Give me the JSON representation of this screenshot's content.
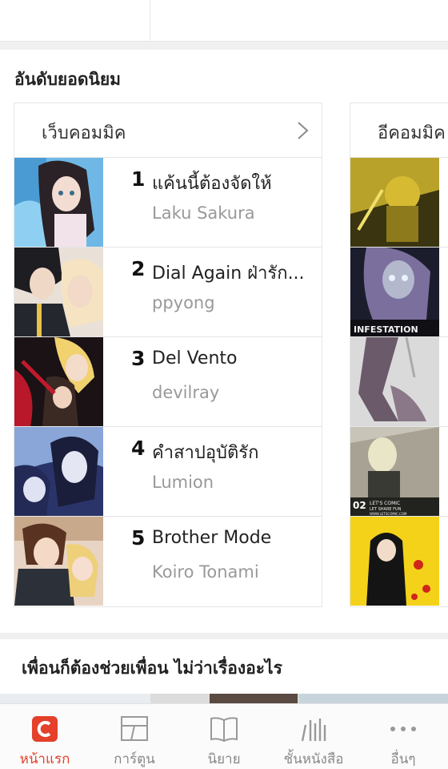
{
  "top_strip": {},
  "ranking": {
    "section_title": "อันดับยอดนิยม",
    "web_comic": {
      "header_label": "เว็บคอมมิค",
      "items": [
        {
          "rank": "1",
          "title": "แค้นนี้ต้องจัดให้",
          "author": "Laku Sakura"
        },
        {
          "rank": "2",
          "title": "Dial Again ฝ่ารัก...",
          "author": "ppyong"
        },
        {
          "rank": "3",
          "title": "Del Vento",
          "author": "devilray"
        },
        {
          "rank": "4",
          "title": "คำสาปอุบัติรัก",
          "author": "Lumion"
        },
        {
          "rank": "5",
          "title": "Brother Mode",
          "author": "Koiro Tonami"
        }
      ]
    },
    "e_comic": {
      "header_label": "อีคอมมิค",
      "thumb_texts": [
        "INFESTATION",
        "02",
        "LET'S COMIC",
        "LET SHARE FUN",
        "WWW.LETSCOMIC.COM"
      ]
    }
  },
  "friends_section": {
    "title": "เพื่อนก็ต้องช่วยเพื่อน ไม่ว่าเรื่องอะไร"
  },
  "tab_bar": {
    "tabs": [
      {
        "label": "หน้าแรก",
        "icon": "home-c-icon",
        "active": true
      },
      {
        "label": "การ์ตูน",
        "icon": "comic-icon",
        "active": false
      },
      {
        "label": "นิยาย",
        "icon": "book-icon",
        "active": false
      },
      {
        "label": "ชั้นหนังสือ",
        "icon": "bookshelf-icon",
        "active": false
      },
      {
        "label": "อื่นๆ",
        "icon": "more-icon",
        "active": false
      }
    ],
    "active_color": "#e4402a"
  }
}
